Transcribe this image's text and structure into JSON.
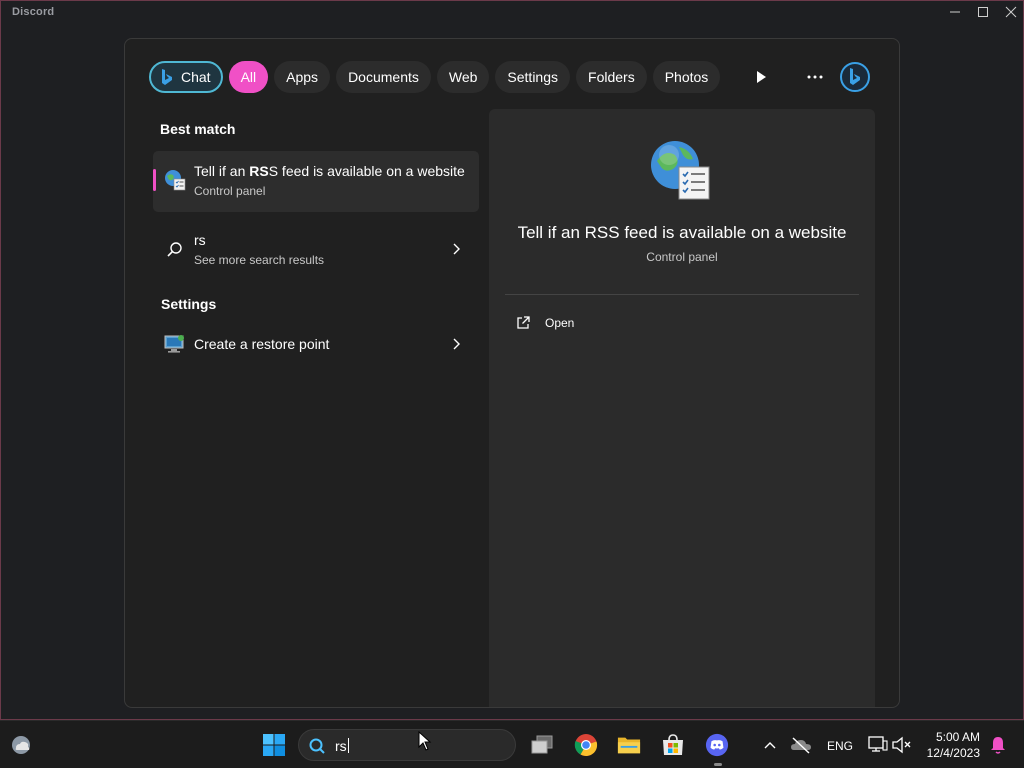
{
  "window": {
    "title": "Discord",
    "controls": {
      "minimize": "minimize-icon",
      "maximize": "maximize-icon",
      "close": "close-icon"
    }
  },
  "search": {
    "filters": [
      "Chat",
      "All",
      "Apps",
      "Documents",
      "Web",
      "Settings",
      "Folders",
      "Photos"
    ],
    "active_filter": "All",
    "accent_color": "#f050c6",
    "chat_border_color": "#4fb8d4",
    "icons": {
      "play": "play-icon",
      "more": "more-icon",
      "bing": "bing-icon"
    },
    "best_match_label": "Best match",
    "best_match": {
      "title_prefix": "Tell if an ",
      "title_bold": "RS",
      "title_suffix": "S feed is available on a website",
      "subtitle": "Control panel",
      "icon": "rss-globe-icon"
    },
    "web_result": {
      "title": "rs",
      "subtitle": "See more search results",
      "icon": "search-icon"
    },
    "settings_label": "Settings",
    "settings_result": {
      "title": "Create a restore point",
      "icon": "system-monitor-icon"
    },
    "detail": {
      "title": "Tell if an RSS feed is available on a website",
      "subtitle": "Control panel",
      "action_open": "Open",
      "action_icon": "open-external-icon"
    }
  },
  "taskbar": {
    "search_value": "rs",
    "tray": {
      "language": "ENG",
      "time": "5:00 AM",
      "date": "12/4/2023"
    }
  }
}
